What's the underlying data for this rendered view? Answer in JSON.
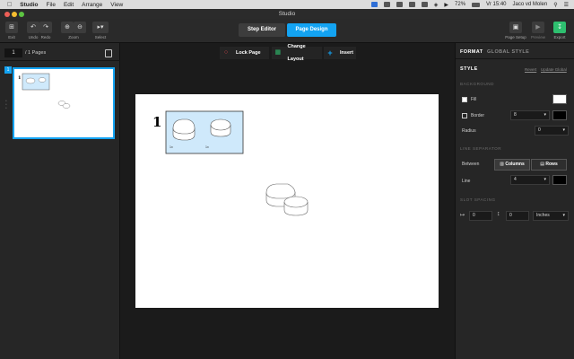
{
  "menubar": {
    "app": "Studio",
    "items": [
      "File",
      "Edit",
      "Arrange",
      "View"
    ],
    "battery": "72%",
    "clock": "Vr 15:40",
    "user": "Jaco vd Molen"
  },
  "window": {
    "title": "Studio"
  },
  "toolbar": {
    "exit": "Exit",
    "undo": "Undo",
    "redo": "Redo",
    "zoom": "Zoom",
    "select": "Select",
    "step_editor": "Step Editor",
    "page_design": "Page Design",
    "page_setup": "Page Setup",
    "preview": "Preview",
    "export": "Export"
  },
  "pages": {
    "current": "1",
    "count_label": "/ 1 Pages",
    "thumb_number": "1",
    "thumb_step": "1"
  },
  "canvas_toolbar": {
    "lock_page": "Lock Page",
    "change_layout": "Change Layout",
    "insert": "Insert"
  },
  "page": {
    "step_number": "1",
    "part_label_1": "1x",
    "part_label_2": "1x"
  },
  "format": {
    "tab_format": "FORMAT",
    "tab_global": "GLOBAL STYLE",
    "style": "STYLE",
    "revert": "Revert",
    "update_global": "Update Global",
    "background": "BACKGROUND",
    "fill": "Fill",
    "border": "Border",
    "border_value": "8",
    "radius": "Radius",
    "radius_value": "0",
    "line_separator": "LINE SEPARATOR",
    "between": "Between",
    "columns": "Columns",
    "rows": "Rows",
    "line": "Line",
    "line_value": "4",
    "slot_spacing": "SLOT SPACING",
    "spacing_h": "0",
    "spacing_v": "0",
    "units": "Inches"
  },
  "colors": {
    "accent": "#13a3f2",
    "export_green": "#2ebf6f",
    "step_bg": "#cfe9fb",
    "fill_swatch": "#ffffff",
    "border_swatch": "#000000"
  }
}
